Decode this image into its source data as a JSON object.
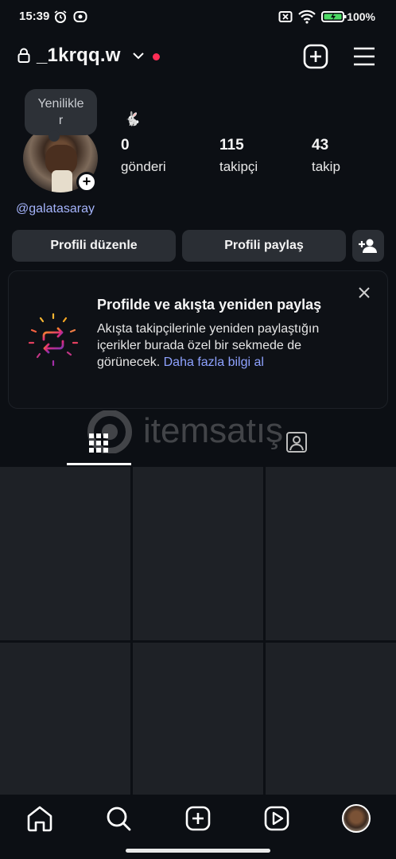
{
  "status_bar": {
    "time": "15:39",
    "battery": "100%",
    "icons": [
      "alarm-icon",
      "record-icon",
      "mute-icon",
      "wifi-icon",
      "battery-icon"
    ]
  },
  "header": {
    "username": "_1krqq.w",
    "icons": [
      "lock-icon",
      "chevron-down-icon",
      "notification-dot",
      "create-icon",
      "menu-icon"
    ]
  },
  "profile": {
    "note_text": "Yenilikle\nr",
    "note_line1": "Yenilikle",
    "note_line2": "r",
    "pronoun_emoji": "🐇",
    "stats": [
      {
        "value": "0",
        "label": "gönderi"
      },
      {
        "value": "115",
        "label": "takipçi"
      },
      {
        "value": "43",
        "label": "takip"
      }
    ],
    "thread_link": "@galatasaray"
  },
  "actions": {
    "edit_profile": "Profili düzenle",
    "share_profile": "Profili paylaş",
    "icons": [
      "add-person-icon"
    ]
  },
  "card": {
    "title": "Profilde ve akışta yeniden paylaş",
    "text": "Akışta takipçilerinle yeniden paylaştığın içerikler burada özel bir sekmede de görünecek.",
    "link": "Daha fazla bilgi al",
    "icons": [
      "repost-icon",
      "close-icon"
    ]
  },
  "tabs": {
    "icons": [
      "grid-icon",
      "tagged-icon"
    ],
    "active": "grid"
  },
  "watermark": {
    "text": "itemsatış"
  },
  "bottom_nav": {
    "icons": [
      "home-icon",
      "search-icon",
      "create-icon",
      "reels-icon",
      "profile-avatar"
    ]
  },
  "colors": {
    "background": "#0c0f14",
    "button": "#2a2e34",
    "link": "#8ea2ff",
    "notification": "#ff2d55"
  }
}
